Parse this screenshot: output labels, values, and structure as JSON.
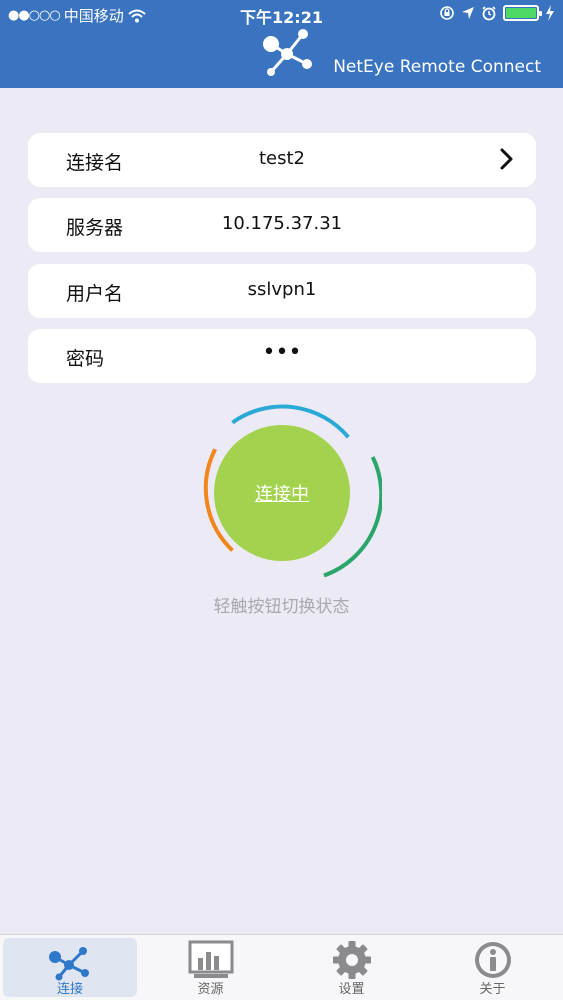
{
  "status": {
    "carrier": "中国移动",
    "time": "下午12:21"
  },
  "header": {
    "brand_title": "NetEye Remote Connect"
  },
  "fields": [
    {
      "label": "连接名",
      "value": "test2"
    },
    {
      "label": "服务器",
      "value": "10.175.37.31"
    },
    {
      "label": "用户名",
      "value": "sslvpn1"
    },
    {
      "label": "密码",
      "value": "•••"
    }
  ],
  "connect": {
    "label": "连接中",
    "hint": "轻触按钮切换状态"
  },
  "tabs": [
    {
      "label": "连接",
      "icon": "network-icon",
      "active": true
    },
    {
      "label": "资源",
      "icon": "chart-monitor-icon",
      "active": false
    },
    {
      "label": "设置",
      "icon": "gear-icon",
      "active": false
    },
    {
      "label": "关于",
      "icon": "info-icon",
      "active": false
    }
  ],
  "colors": {
    "header_bg": "#3a74c0",
    "page_bg": "#eceaf4",
    "connect_green": "#a3d34e",
    "arc_blue": "#29a9d6",
    "arc_orange": "#f0861c",
    "arc_green": "#2aa56b",
    "tab_active": "#2f77c9"
  }
}
